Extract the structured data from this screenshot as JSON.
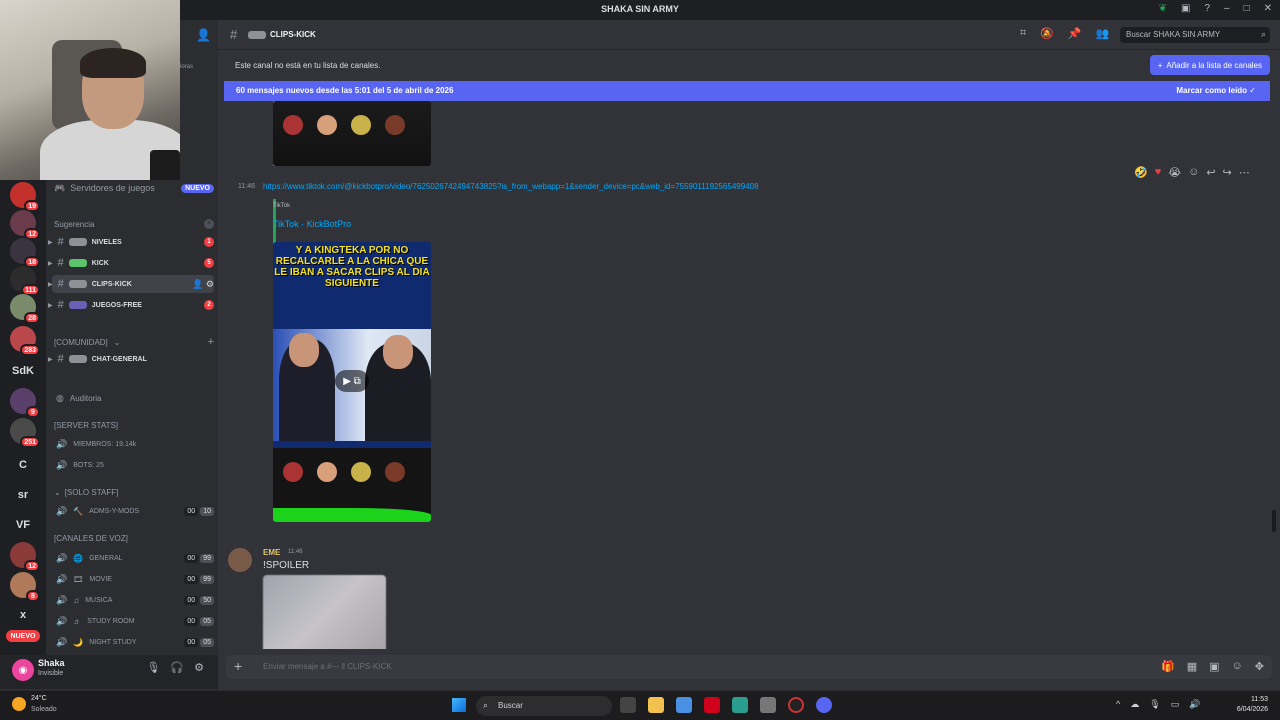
{
  "window": {
    "title": "SHAKA SIN ARMY"
  },
  "server_list": {
    "badges": [
      "19",
      "12",
      "18",
      "111",
      "28",
      "283",
      "9",
      "251",
      "12",
      "8"
    ],
    "text_items": [
      "SdK",
      "C",
      "sr",
      "VF",
      "x"
    ],
    "nuevo_label": "NUEVO"
  },
  "channel_sidebar": {
    "header_partial": "ioras",
    "games_label": "Servidores de juegos",
    "games_badge": "NUEVO",
    "suggestion_label": "Sugerencia",
    "text_channels": [
      {
        "name": "NIVELES",
        "badge": "1"
      },
      {
        "name": "KICK",
        "badge": "5"
      },
      {
        "name": "CLIPS-KICK"
      },
      {
        "name": "JUEGOS-FREE",
        "badge": "2"
      }
    ],
    "community_label": "[COMUNIDAD]",
    "chat_general": "CHAT-GENERAL",
    "audit_label": "Auditoria",
    "server_stats_label": "[SERVER STATS]",
    "members_label": "MIEMBROS: 19.14k",
    "bots_label": "BOTS: 25",
    "solo_staff_label": "[SOLO STAFF]",
    "adms_label": "ADMS-Y-MODS",
    "adms_count": [
      "00",
      "10"
    ],
    "voice_label": "[CANALES DE VOZ]",
    "voice_channels": [
      {
        "name": "GENERAL",
        "count": [
          "00",
          "99"
        ]
      },
      {
        "name": "MOVIE",
        "count": [
          "00",
          "99"
        ]
      },
      {
        "name": "MUSICA",
        "count": [
          "00",
          "50"
        ]
      },
      {
        "name": "STUDY ROOM",
        "count": [
          "00",
          "05"
        ]
      },
      {
        "name": "NIGHT STUDY",
        "count": [
          "00",
          "05"
        ]
      }
    ]
  },
  "user": {
    "name": "Shaka",
    "status": "Invisible"
  },
  "header": {
    "channel_name": "CLIPS-KICK",
    "search_placeholder": "Buscar SHAKA SIN ARMY"
  },
  "notice": {
    "text": "Este canal no está en tu lista de canales.",
    "button": "Añadir a la lista de canales"
  },
  "new_messages": {
    "text": "60 mensajes nuevos desde las 5:01 del 5 de abril de 2026",
    "mark_read": "Marcar como leído"
  },
  "messages": {
    "m1_time": "11:46",
    "m1_link": "https://www.tiktok.com/@kickbotpro/video/7625026742494743825?is_from_webapp=1&sender_device=pc&web_id=7559011192565499408",
    "embed_provider": "TikTok",
    "embed_title": "TikTok · KickBotPro",
    "video_caption": "Y A KINGTEKA POR NO RECALCARLE A LA CHICA QUE LE IBAN A SACAR CLIPS AL DIA SIGUIENTE",
    "m2_user": "EME",
    "m2_time": "11:46",
    "m2_text": "!SPOILER"
  },
  "composer": {
    "placeholder": "Enviar mensaje a #---  ‖ CLIPS-KICK"
  },
  "taskbar": {
    "temp": "24°C",
    "condition": "Soleado",
    "search": "Buscar",
    "time": "11:53",
    "date": "6/04/2026"
  },
  "colors": {
    "accent": "#5865f2",
    "link": "#00a8fc",
    "badge": "#f23f43",
    "username_eme": "#e0c36c"
  }
}
